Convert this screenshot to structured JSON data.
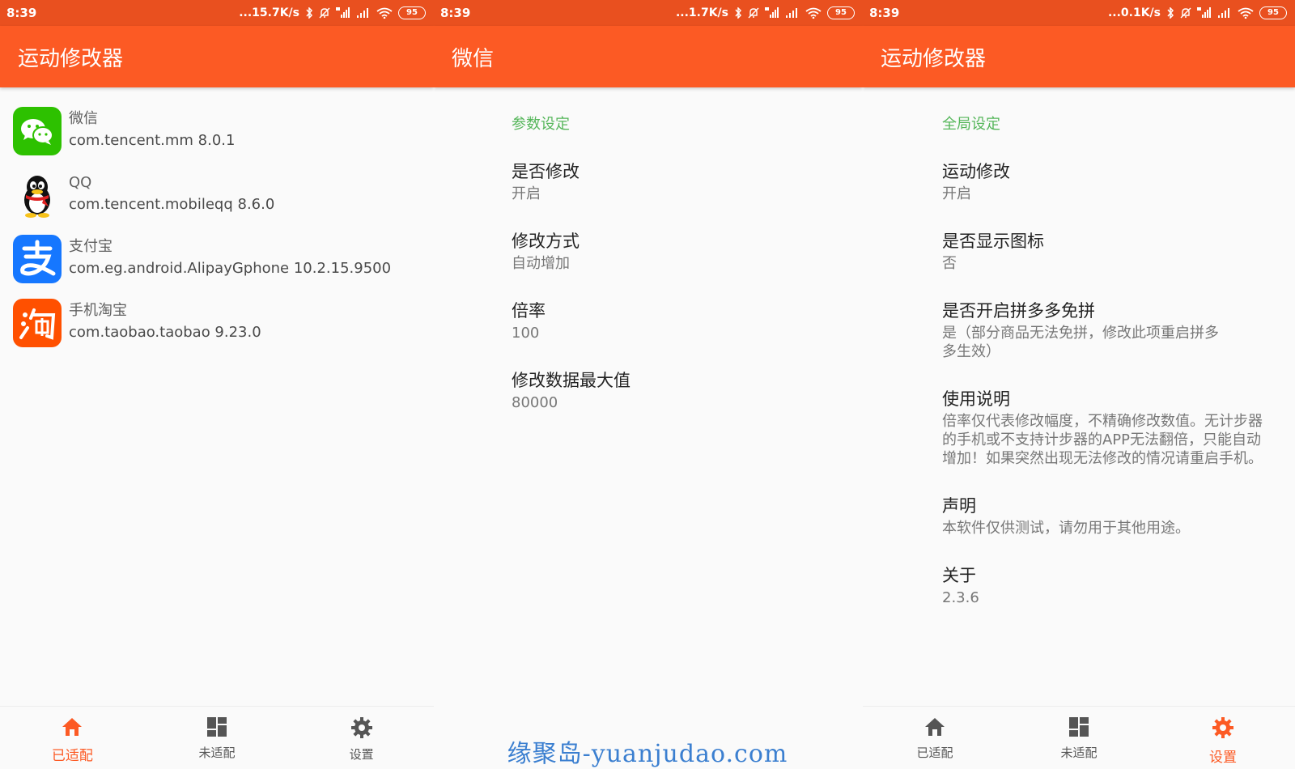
{
  "colors": {
    "accent": "#fc5a24",
    "status_bar": "#e9501f",
    "category": "#55b65a",
    "checkbox": "#4caf50"
  },
  "screens": [
    {
      "status": {
        "time": "8:39",
        "speed": "...15.7K/s",
        "battery": "95"
      },
      "title": "运动修改器",
      "apps": [
        {
          "name": "微信",
          "pkg": "com.tencent.mm 8.0.1",
          "icon": "wechat-icon"
        },
        {
          "name": "QQ",
          "pkg": "com.tencent.mobileqq 8.6.0",
          "icon": "qq-icon"
        },
        {
          "name": "支付宝",
          "pkg": "com.eg.android.AlipayGphone 10.2.15.9500",
          "icon": "alipay-icon"
        },
        {
          "name": "手机淘宝",
          "pkg": "com.taobao.taobao 9.23.0",
          "icon": "taobao-icon"
        }
      ]
    },
    {
      "status": {
        "time": "8:39",
        "speed": "...1.7K/s",
        "battery": "95"
      },
      "title": "微信",
      "category": "参数设定",
      "prefs": [
        {
          "title": "是否修改",
          "summary": "开启",
          "checked": true
        },
        {
          "title": "修改方式",
          "summary": "自动增加",
          "checked": true
        },
        {
          "title": "倍率",
          "summary": "100"
        },
        {
          "title": "修改数据最大值",
          "summary": "80000"
        }
      ]
    },
    {
      "status": {
        "time": "8:39",
        "speed": "...0.1K/s",
        "battery": "95"
      },
      "title": "运动修改器",
      "category": "全局设定",
      "prefs": [
        {
          "title": "运动修改",
          "summary": "开启",
          "checked": true
        },
        {
          "title": "是否显示图标",
          "summary": "否",
          "checked": false
        },
        {
          "title": "是否开启拼多多免拼",
          "summary": "是（部分商品无法免拼，修改此项重启拼多多生效）",
          "checked": true
        },
        {
          "title": "使用说明",
          "summary": "倍率仅代表修改幅度，不精确修改数值。无计步器的手机或不支持计步器的APP无法翻倍，只能自动增加！如果突然出现无法修改的情况请重启手机。"
        },
        {
          "title": "声明",
          "summary": "本软件仅供测试，请勿用于其他用途。"
        },
        {
          "title": "关于",
          "summary": "2.3.6"
        }
      ]
    }
  ],
  "nav": {
    "adapted": "已适配",
    "unadapted": "未适配",
    "settings": "设置"
  },
  "watermark": "缘聚岛-yuanjudao.com"
}
